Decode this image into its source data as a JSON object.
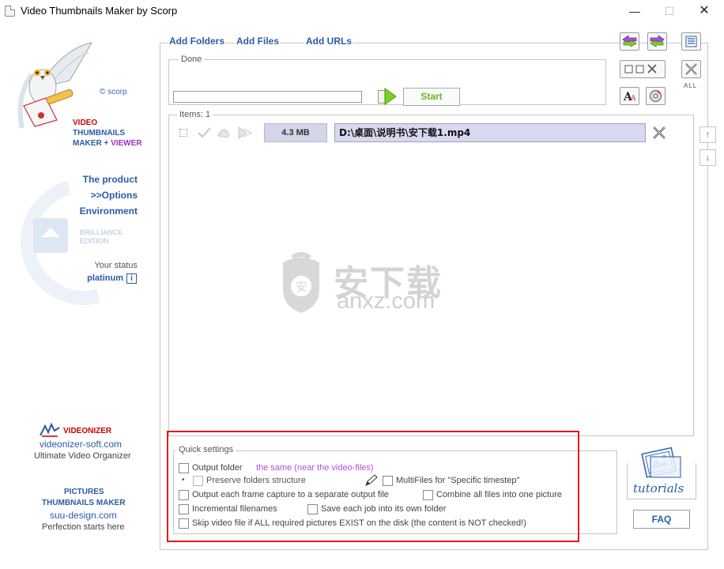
{
  "window": {
    "title": "Video Thumbnails Maker by Scorp",
    "minimize": "—",
    "maximize": "☐",
    "close": "✕"
  },
  "sidebar": {
    "author": "© scorp",
    "product_line1": "VIDEO",
    "product_line2": "THUMBNAILS",
    "product_line3a": "MAKER + ",
    "product_line3b": "VIEWER",
    "nav": [
      {
        "label": "The product"
      },
      {
        "label": ">>Options"
      },
      {
        "label": "Environment"
      }
    ],
    "edition_line1": "BRILLIANCE",
    "edition_line2": "EDITION",
    "status_label": "Your status",
    "status_value": "platinum",
    "status_info": "i",
    "videonizer": {
      "name": "VIDEONIZER",
      "url": "videonizer-soft.com",
      "tagline": "Ultimate Video Organizer"
    },
    "pictures_tm": {
      "line1": "PICTURES",
      "line2": "THUMBNAILS MAKER",
      "url": "suu-design.com",
      "tagline": "Perfection starts here"
    }
  },
  "toolbar": {
    "add_folders": "Add Folders",
    "add_files": "Add Files",
    "add_urls": "Add URLs",
    "all_label": "ALL",
    "font_btn": "A"
  },
  "progress": {
    "status": "Done",
    "value": 0,
    "start_label": "Start"
  },
  "items": {
    "label": "Items: 1",
    "list": [
      {
        "size": "4.3 MB",
        "path": "D:\\桌面\\说明书\\安下载1.mp4"
      }
    ],
    "scroll_up": "↑",
    "scroll_down": "↓"
  },
  "watermark": {
    "cn": "安下载",
    "url": "anxz.com"
  },
  "quick_settings": {
    "title": "Quick settings",
    "output_folder": "Output folder",
    "output_folder_value": "the same (near the video-files)",
    "bullet": "•",
    "preserve_structure": "Preserve folders structure",
    "multifiles": "MultiFiles for \"Specific timestep\"",
    "each_frame": "Output each frame capture to a separate output file",
    "combine": "Combine all files into one picture",
    "incremental": "Incremental filenames",
    "own_folder": "Save each job into its own folder",
    "skip": "Skip video file if ALL required pictures EXIST on the disk (the content is NOT checked!)"
  },
  "help": {
    "tutorials": "tutorials",
    "faq": "FAQ"
  },
  "colors": {
    "link_blue": "#2b5ba8",
    "start_green": "#66b81e",
    "highlight_red": "#e01b1b",
    "output_folder_value": "#b04fd6"
  }
}
